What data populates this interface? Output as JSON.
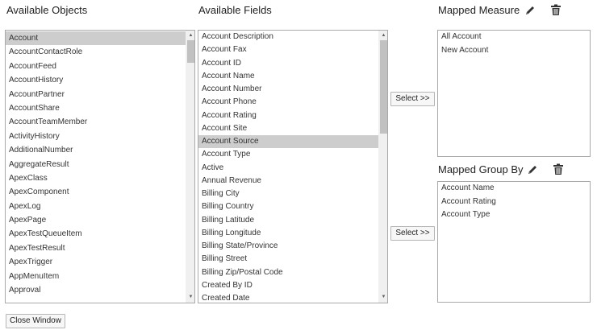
{
  "headings": {
    "available_objects": "Available Objects",
    "available_fields": "Available Fields",
    "mapped_measure": "Mapped Measure",
    "mapped_group_by": "Mapped Group By"
  },
  "objects": [
    "Account",
    "AccountContactRole",
    "AccountFeed",
    "AccountHistory",
    "AccountPartner",
    "AccountShare",
    "AccountTeamMember",
    "ActivityHistory",
    "AdditionalNumber",
    "AggregateResult",
    "ApexClass",
    "ApexComponent",
    "ApexLog",
    "ApexPage",
    "ApexTestQueueItem",
    "ApexTestResult",
    "ApexTrigger",
    "AppMenuItem",
    "Approval"
  ],
  "objects_selected": "Account",
  "fields": [
    "Account Description",
    "Account Fax",
    "Account ID",
    "Account Name",
    "Account Number",
    "Account Phone",
    "Account Rating",
    "Account Site",
    "Account Source",
    "Account Type",
    "Active",
    "Annual Revenue",
    "Billing City",
    "Billing Country",
    "Billing Latitude",
    "Billing Longitude",
    "Billing State/Province",
    "Billing Street",
    "Billing Zip/Postal Code",
    "Created By ID",
    "Created Date"
  ],
  "fields_selected": "Account Source",
  "mapped_measure": [
    "All Account",
    "New Account"
  ],
  "mapped_group_by": [
    "Account Name",
    "Account Rating",
    "Account Type"
  ],
  "buttons": {
    "select_measure": "Select >>",
    "select_group_by": "Select >>",
    "close_window": "Close Window"
  },
  "icons": {
    "edit": "pencil-icon",
    "delete": "trash-icon"
  },
  "scrollbars": {
    "objects": {
      "thumb_start": 0.0,
      "thumb_end": 0.09
    },
    "fields": {
      "thumb_start": 0.0,
      "thumb_end": 0.37
    }
  }
}
